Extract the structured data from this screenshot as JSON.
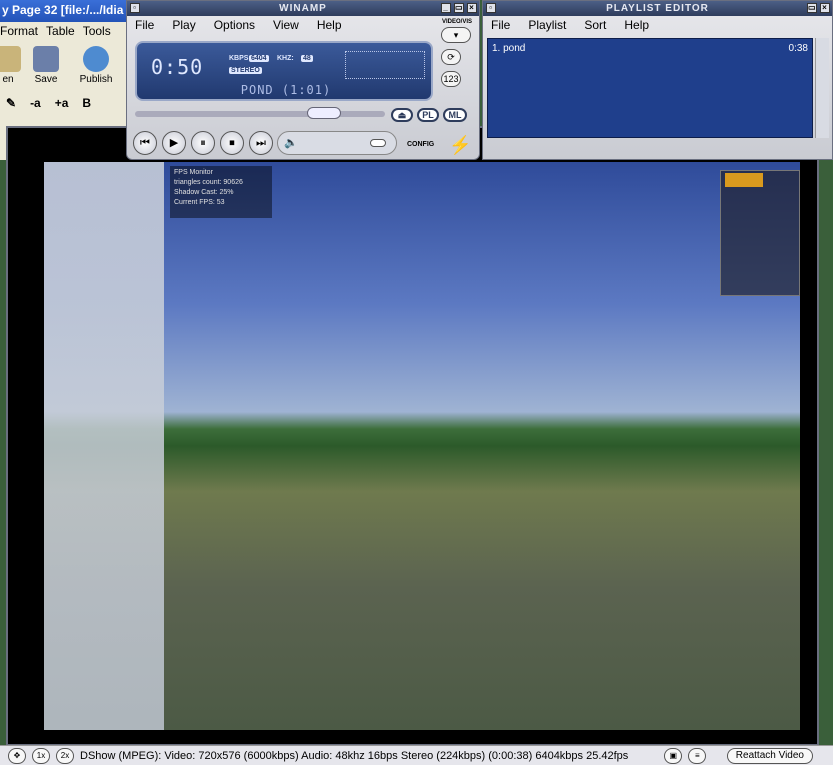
{
  "bg_app": {
    "title": "y Page 32 [file:/.../Idia",
    "menu": [
      "Format",
      "Table",
      "Tools"
    ],
    "tools": [
      "en",
      "Save",
      "Publish"
    ],
    "format_btns": [
      "-a",
      "+a",
      "B"
    ]
  },
  "winamp": {
    "title": "WINAMP",
    "menu": [
      "File",
      "Play",
      "Options",
      "View",
      "Help"
    ],
    "time": "0:50",
    "kbps_label": "KBPS:",
    "kbps_value": "6404",
    "khz_label": "KHZ:",
    "khz_value": "48",
    "stereo_label": "STEREO",
    "track": "POND (1:01)",
    "video_vis_label": "VIDEO/VIS",
    "repeat_btn": "⟳",
    "shuffle_btn": "123",
    "pl_btn": "PL",
    "ml_btn": "ML",
    "eject_btn": "⏏",
    "config_label": "CONFIG",
    "controls": [
      "⏮",
      "▶",
      "⏸",
      "⏹",
      "⏭"
    ]
  },
  "playlist": {
    "title": "PLAYLIST EDITOR",
    "menu": [
      "File",
      "Playlist",
      "Sort",
      "Help"
    ],
    "items": [
      {
        "label": "1. pond",
        "duration": "0:38"
      }
    ]
  },
  "video_overlay": {
    "line1": "FPS Monitor",
    "line2": "triangles count: 90626",
    "line3": "Shadow Cast: 25%",
    "line4": "Current FPS: 53"
  },
  "status": {
    "zoom1": "1x",
    "zoom2": "2x",
    "info": "DShow (MPEG): Video: 720x576 (6000kbps) Audio: 48khz 16bps Stereo (224kbps) (0:00:38) 6404kbps 25.42fps",
    "reattach": "Reattach Video"
  },
  "colors": {
    "display_bg": "#21396f",
    "playlist_bg": "#1f3f8c",
    "titlebar": "#2e3c5c"
  }
}
